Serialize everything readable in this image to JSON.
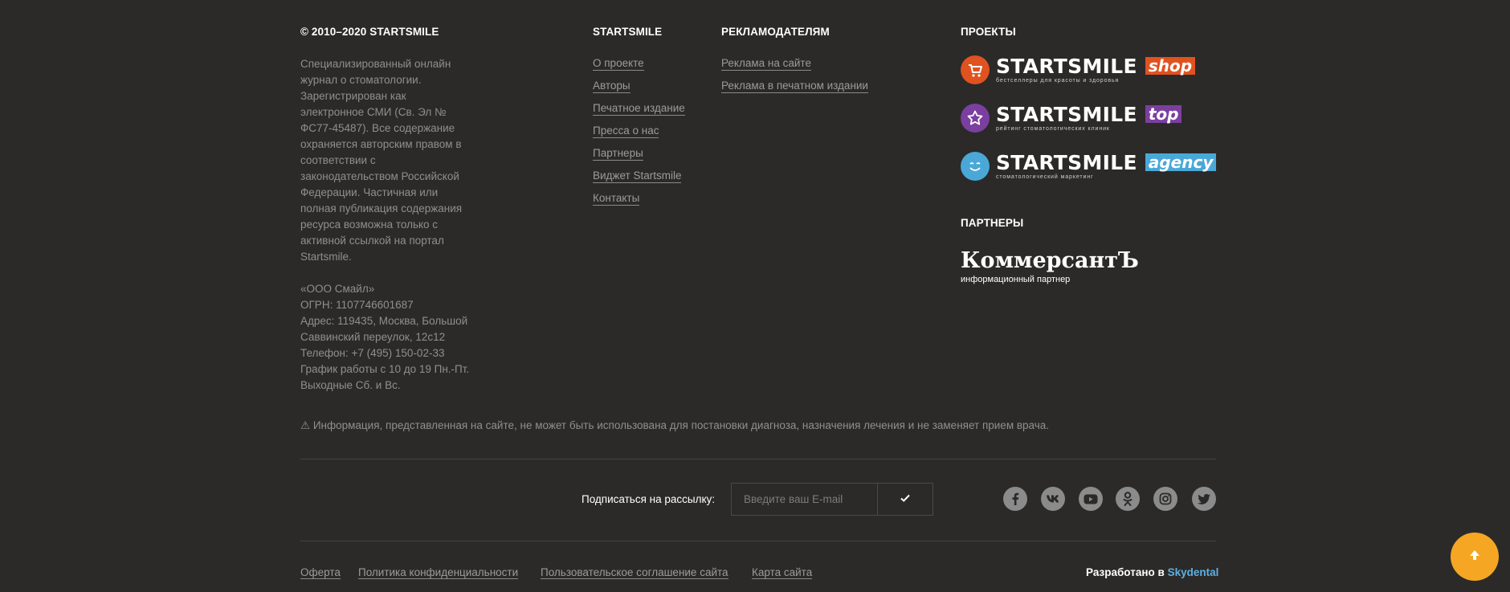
{
  "copyright": "© 2010–2020 STARTSMILE",
  "about": {
    "lines": [
      "Специализированный онлайн",
      "журнал о стоматологии.",
      "Зарегистрирован как",
      "электронное СМИ (Св. Эл №",
      "ФС77-45487). Все содержание",
      "охраняется авторским правом в",
      "соответствии с",
      "законодательством Российской",
      "Федерации. Частичная или",
      "полная публикация содержания",
      "ресурса возможна только с",
      "активной ссылкой на портал",
      "Startsmile."
    ],
    "company_lines": [
      "«ООО Смайл»",
      "ОГРН: 1107746601687",
      "Адрес: 119435, Москва, Большой",
      "Саввинский переулок, 12с12",
      "Телефон: +7 (495) 150-02-33",
      "График работы с 10 до 19 Пн.-Пт.",
      "Выходные Сб. и Вс."
    ]
  },
  "startsmile_col": {
    "heading": "STARTSMILE",
    "links": [
      "О проекте",
      "Авторы",
      "Печатное издание",
      "Пресса о нас",
      "Партнеры",
      "Виджет Startsmile",
      "Контакты"
    ]
  },
  "advertisers_col": {
    "heading": "РЕКЛАМОДАТЕЛЯМ",
    "links": [
      "Реклама на сайте",
      "Реклама в печатном издании"
    ]
  },
  "projects": {
    "heading": "ПРОЕКТЫ",
    "items": [
      {
        "brand": "STARTSMILE",
        "tag": "shop",
        "sub": "бестселлеры для красоты и здоровья",
        "color": "#e0521f",
        "icon": "cart-icon"
      },
      {
        "brand": "STARTSMILE",
        "tag": "top",
        "sub": "рейтинг стоматологических клиник",
        "color": "#7b3fa0",
        "icon": "star-icon"
      },
      {
        "brand": "STARTSMILE",
        "tag": "agency",
        "sub": "стоматологический маркетинг",
        "color": "#4aa8d8",
        "icon": "smile-face-icon"
      }
    ]
  },
  "partners": {
    "heading": "ПАРТНЕРЫ",
    "name": "КоммерсантЪ",
    "sub": "информационный партнер"
  },
  "disclaimer": "⚠ Информация, представленная на сайте, не может быть использована для постановки диагноза, назначения лечения и не заменяет прием врача.",
  "subscribe": {
    "label": "Подписаться на рассылку:",
    "placeholder": "Введите ваш E-mail",
    "value": ""
  },
  "social": [
    "facebook-icon",
    "vk-icon",
    "youtube-icon",
    "odnoklassniki-icon",
    "instagram-icon",
    "twitter-icon"
  ],
  "bottom_links": [
    "Оферта",
    "Политика конфиденциальности",
    "Пользовательское соглашение сайта",
    "Карта сайта"
  ],
  "credits": {
    "text": "Разработано в",
    "link": "Skydental"
  },
  "colors": {
    "background": "#2b2a29",
    "accent_orange": "#f5a623",
    "link_blue": "#5fb0e0"
  }
}
